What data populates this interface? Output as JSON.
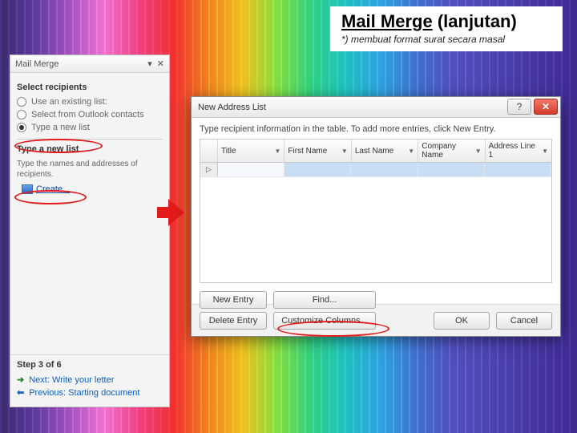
{
  "slide": {
    "title_bold": "Mail Merge",
    "title_rest": "(lanjutan)",
    "subtitle": "*) membuat format surat secara masal"
  },
  "taskpane": {
    "title": "Mail Merge",
    "section_select": "Select recipients",
    "radio_existing": "Use an existing list:",
    "radio_outlook": "Select from Outlook contacts",
    "radio_newlist": "Type a new list",
    "section_type": "Type a new list",
    "instruction": "Type the names and addresses of recipients.",
    "create": "Create...",
    "step": "Step 3 of 6",
    "next": "Next: Write your letter",
    "prev": "Previous: Starting document"
  },
  "dialog": {
    "title": "New Address List",
    "instruction": "Type recipient information in the table. To add more entries, click New Entry.",
    "columns": [
      "Title",
      "First Name",
      "Last Name",
      "Company Name",
      "Address Line 1"
    ],
    "btn_new": "New Entry",
    "btn_find": "Find...",
    "btn_delete": "Delete Entry",
    "btn_customize": "Customize Columns...",
    "btn_ok": "OK",
    "btn_cancel": "Cancel"
  }
}
